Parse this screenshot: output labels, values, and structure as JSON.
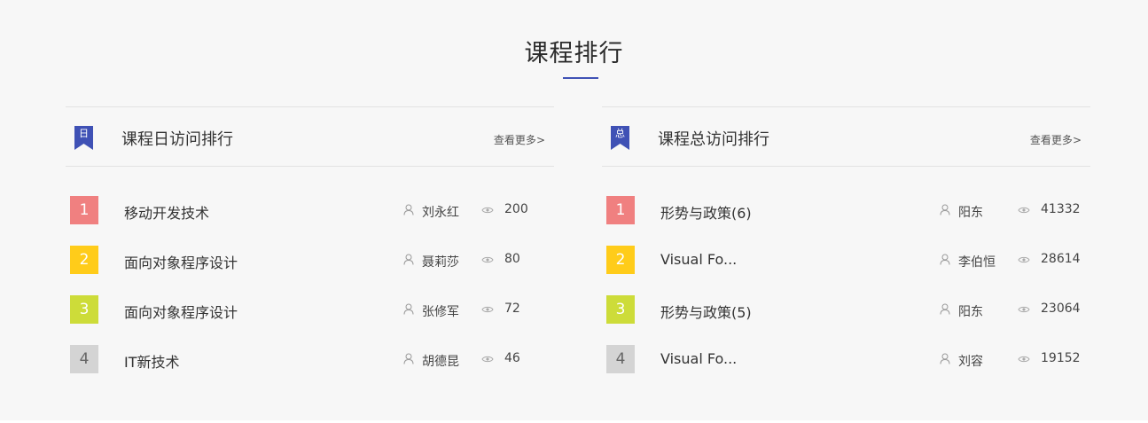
{
  "section": {
    "title": "课程排行"
  },
  "panels": [
    {
      "ribbon_text": "日",
      "title": "课程日访问排行",
      "more": "查看更多",
      "more_arrow": ">",
      "rows": [
        {
          "rank": "1",
          "name": "移动开发技术",
          "teacher": "刘永红",
          "visits": "200"
        },
        {
          "rank": "2",
          "name": "面向对象程序设计",
          "teacher": "聂莉莎",
          "visits": "80"
        },
        {
          "rank": "3",
          "name": "面向对象程序设计",
          "teacher": "张修军",
          "visits": "72"
        },
        {
          "rank": "4",
          "name": "IT新技术",
          "teacher": "胡德昆",
          "visits": "46"
        }
      ]
    },
    {
      "ribbon_text": "总",
      "title": "课程总访问排行",
      "more": "查看更多",
      "more_arrow": ">",
      "rows": [
        {
          "rank": "1",
          "name": "形势与政策(6)",
          "teacher": "阳东",
          "visits": "41332"
        },
        {
          "rank": "2",
          "name": "Visual Fo...",
          "teacher": "李伯恒",
          "visits": "28614"
        },
        {
          "rank": "3",
          "name": "形势与政策(5)",
          "teacher": "阳东",
          "visits": "23064"
        },
        {
          "rank": "4",
          "name": "Visual Fo...",
          "teacher": "刘容",
          "visits": "19152"
        }
      ]
    }
  ],
  "colors": {
    "accent": "#3f51b5",
    "rank_1": "#f08080",
    "rank_2": "#ffcc1a",
    "rank_3": "#cddc39",
    "rank_4": "#d4d4d4",
    "background": "#f7f7f7"
  },
  "icons": {
    "teacher": "user-icon",
    "visits": "eye-icon",
    "ribbon": "bookmark-ribbon-icon"
  }
}
